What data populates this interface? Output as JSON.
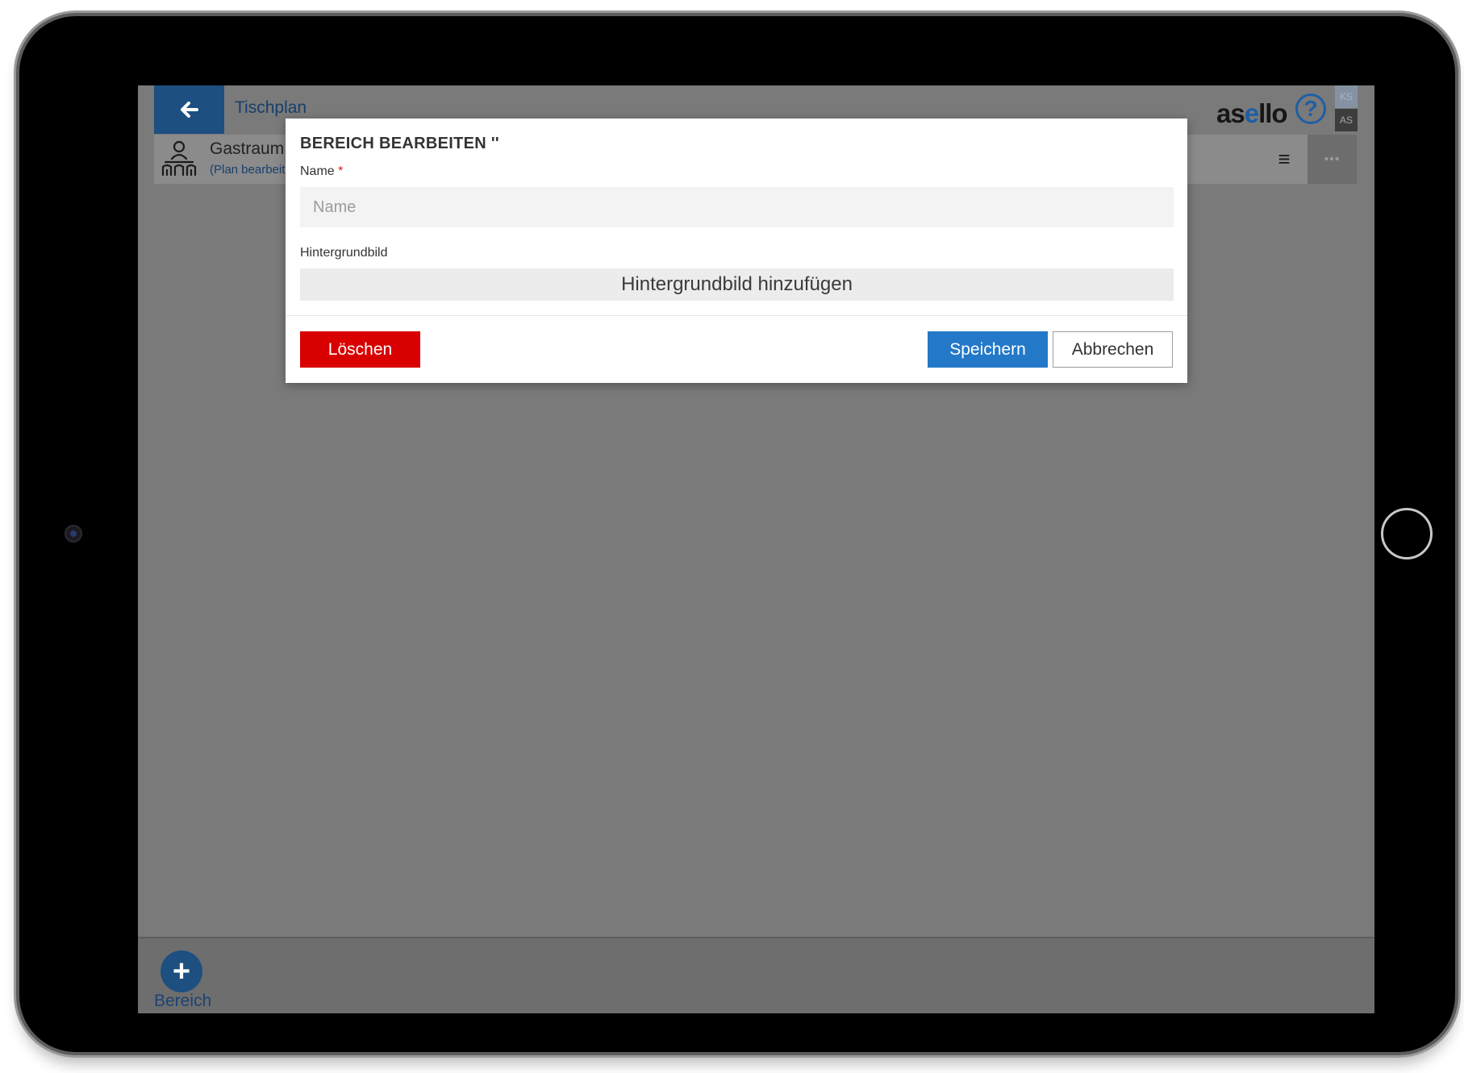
{
  "header": {
    "back_title": "Tischplan",
    "logo_prefix": "as",
    "logo_accent": "e",
    "logo_suffix": "llo",
    "help_symbol": "?",
    "user_badges": [
      "KS",
      "AS"
    ]
  },
  "area_bar": {
    "area_name": "Gastraum",
    "edit_link": "(Plan bearbeiten)",
    "more_symbol": "•••"
  },
  "dialog": {
    "title": "BEREICH BEARBEITEN ''",
    "name_label": "Name",
    "required_marker": "*",
    "name_value": "",
    "name_placeholder": "Name",
    "background_label": "Hintergrundbild",
    "background_button": "Hintergrundbild hinzufügen",
    "delete_label": "Löschen",
    "save_label": "Speichern",
    "cancel_label": "Abbrechen"
  },
  "footer": {
    "add_area_label": "Bereich"
  },
  "colors": {
    "primary": "#1d4f80",
    "save": "#2379c8",
    "delete": "#d80000",
    "overlay": "#7a7a7a"
  },
  "icons": [
    "arrow-left-icon",
    "help-icon",
    "table-seating-icon",
    "hamburger-menu-icon",
    "more-dots-icon",
    "plus-icon"
  ]
}
